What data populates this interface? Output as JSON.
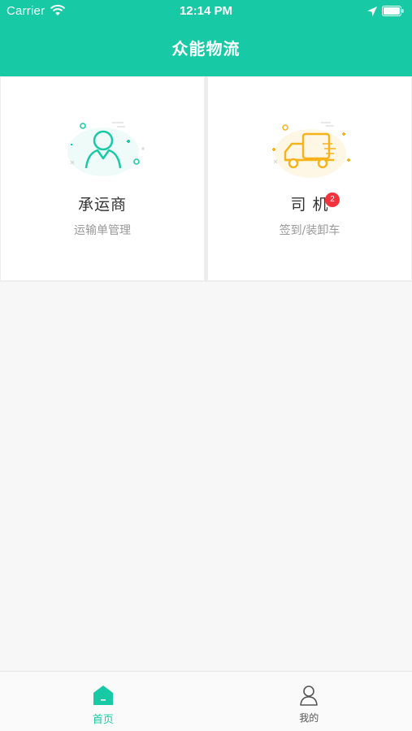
{
  "colors": {
    "accent": "#17c9a5",
    "driver_accent": "#f6b21b",
    "badge": "#f5313b"
  },
  "status_bar": {
    "carrier": "Carrier",
    "time": "12:14 PM"
  },
  "nav": {
    "title": "众能物流"
  },
  "cards": [
    {
      "icon": "person-icon",
      "title": "承运商",
      "subtitle": "运输单管理"
    },
    {
      "icon": "truck-icon",
      "title": "司 机",
      "subtitle": "签到/装卸车",
      "badge": "2"
    }
  ],
  "tabs": [
    {
      "icon": "home-icon",
      "label": "首页",
      "active": true
    },
    {
      "icon": "user-icon",
      "label": "我的",
      "active": false
    }
  ]
}
